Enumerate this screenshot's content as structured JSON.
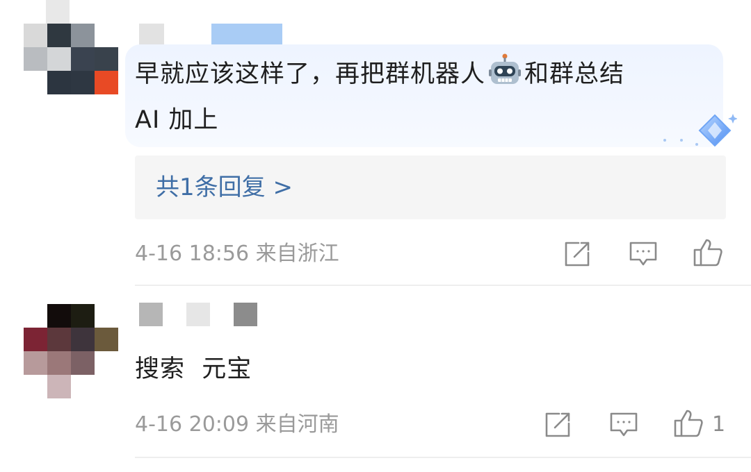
{
  "comments": [
    {
      "text_line1": "早就应该这样了，再把群机器人",
      "text_line1_after": "和群总结",
      "text_line2": "AI 加上",
      "reply_label": "共1条回复 >",
      "date": "4-16 18:56",
      "location": "来自浙江",
      "like_count": ""
    },
    {
      "text": "搜索  元宝",
      "date": "4-16 20:09",
      "location": "来自河南",
      "like_count": "1"
    }
  ],
  "icons": {
    "robot": "robot-emoji-icon",
    "share": "share-icon",
    "reply": "comment-icon",
    "like": "thumbs-up-icon",
    "ai_badge": "ai-diamond-badge-icon"
  },
  "colors": {
    "reply_link": "#3f6ea6",
    "meta_text": "#9a9a9a",
    "bubble_bg": "#eef4ff"
  }
}
